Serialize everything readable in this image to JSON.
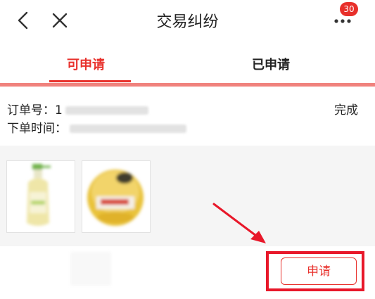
{
  "header": {
    "title": "交易纠纷",
    "back_icon": "chevron-left-icon",
    "close_icon": "close-icon",
    "more_icon": "more-dots-icon",
    "badge_count": "30"
  },
  "tabs": [
    {
      "label": "可申请",
      "active": true
    },
    {
      "label": "已申请",
      "active": false
    }
  ],
  "order": {
    "number_label": "订单号：",
    "number_visible_prefix": "1",
    "time_label": "下单时间：",
    "status": "完成"
  },
  "actions": {
    "apply_label": "申请"
  },
  "colors": {
    "accent": "#e8302b",
    "tab_rule": "#f0827d",
    "section_bg": "#f5f5f5"
  }
}
